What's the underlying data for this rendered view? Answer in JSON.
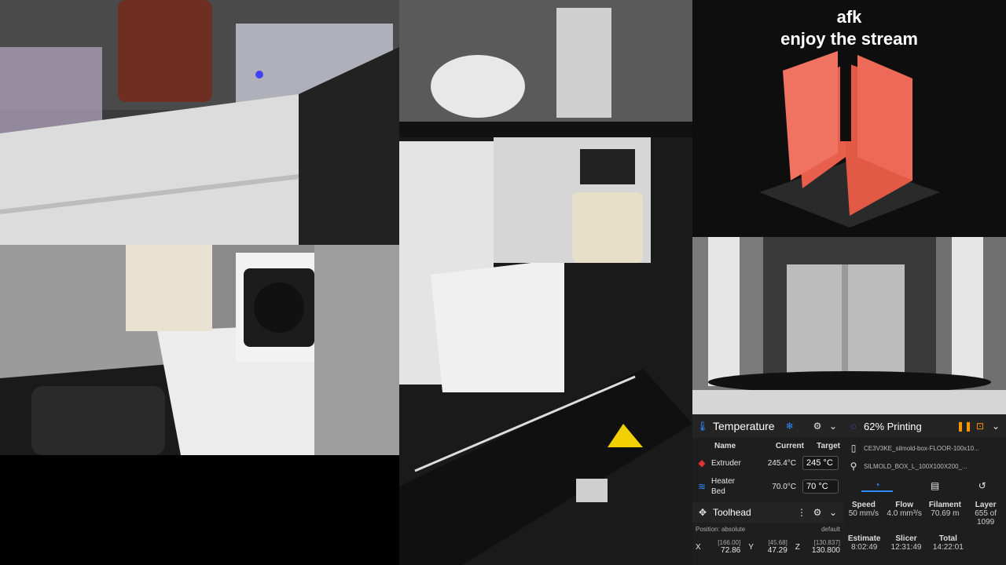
{
  "overlay": {
    "line1": "afk",
    "line2": "enjoy the stream"
  },
  "colors": {
    "accent": "#2f8cff",
    "print_model": "#e8604c",
    "paused_orange": "#ff9800"
  },
  "temperature": {
    "title": "Temperature",
    "columns": {
      "name": "Name",
      "current": "Current",
      "target": "Target"
    },
    "extruder": {
      "name": "Extruder",
      "current": "245.4°C",
      "target": "245",
      "unit": "°C"
    },
    "bed": {
      "name_line1": "Heater",
      "name_line2": "Bed",
      "current": "70.0°C",
      "target": "70",
      "unit": "°C"
    }
  },
  "toolhead": {
    "title": "Toolhead",
    "position_mode": "Position: absolute",
    "profile": "default",
    "x": {
      "label": "X",
      "max": "[166.00]",
      "value": "72.86"
    },
    "y": {
      "label": "Y",
      "max": "[45.68]",
      "value": "47.29"
    },
    "z": {
      "label": "Z",
      "max": "[130.837]",
      "value": "130.800"
    }
  },
  "status": {
    "title": "62% Printing",
    "progress": 0.62,
    "file1": "CE3V3KE_silmold-box-FLOOR-100x10...",
    "file2": "SILMOLD_BOX_L_100X100X200_...",
    "stats": {
      "speed": {
        "label": "Speed",
        "value": "50 mm/s"
      },
      "flow": {
        "label": "Flow",
        "value": "4.0 mm³/s"
      },
      "filament": {
        "label": "Filament",
        "value": "70.69 m"
      },
      "layer": {
        "label": "Layer",
        "value": "655 of 1099"
      }
    },
    "times": {
      "estimate": {
        "label": "Estimate",
        "value": "8:02:49"
      },
      "slicer": {
        "label": "Slicer",
        "value": "12:31:49"
      },
      "total": {
        "label": "Total",
        "value": "14:22:01"
      }
    }
  },
  "icons": {
    "snowflake": "snowflake-icon",
    "gear": "gear-icon",
    "chevron": "chevron-down-icon",
    "pause": "pause-icon",
    "stop": "stop-icon",
    "gauge": "gauge-icon",
    "file": "file-icon",
    "history": "history-icon",
    "move": "move-icon"
  }
}
